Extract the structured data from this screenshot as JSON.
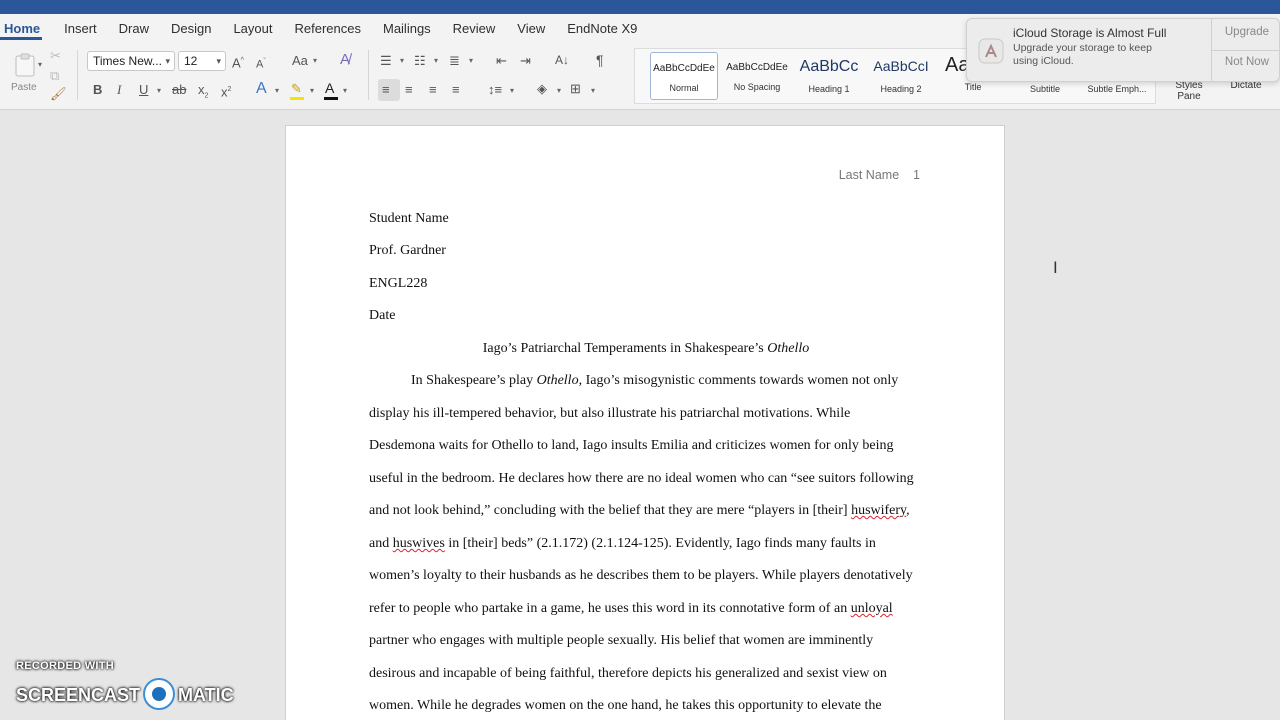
{
  "tabs": [
    {
      "label": "Home"
    },
    {
      "label": "Insert"
    },
    {
      "label": "Draw"
    },
    {
      "label": "Design"
    },
    {
      "label": "Layout"
    },
    {
      "label": "References"
    },
    {
      "label": "Mailings"
    },
    {
      "label": "Review"
    },
    {
      "label": "View"
    },
    {
      "label": "EndNote X9"
    }
  ],
  "clipboard": {
    "paste_label": "Paste"
  },
  "font": {
    "family": "Times New...",
    "size": "12"
  },
  "styles": [
    {
      "sample": "AaBbCcDdEe",
      "name": "Normal"
    },
    {
      "sample": "AaBbCcDdEe",
      "name": "No Spacing"
    },
    {
      "sample": "AaBbCc",
      "name": "Heading 1"
    },
    {
      "sample": "AaBbCcI",
      "name": "Heading 2"
    },
    {
      "sample": "Aa",
      "name": "Title"
    },
    {
      "sample": "",
      "name": "Subtitle"
    },
    {
      "sample": "",
      "name": "Subtle Emph..."
    }
  ],
  "right_ribbon": {
    "styles_pane_1": "Styles",
    "styles_pane_2": "Pane",
    "dictate": "Dictate"
  },
  "notification": {
    "title": "iCloud Storage is Almost Full",
    "body": "Upgrade your storage to keep using iCloud.",
    "upgrade": "Upgrade",
    "not_now": "Not Now"
  },
  "document": {
    "header": "Last Name    1",
    "student": "Student Name",
    "prof": "Prof. Gardner",
    "course": "ENGL228",
    "date": "Date",
    "title_pre": "Iago’s Patriarchal Temperaments in Shakespeare’s ",
    "title_italic": "Othello",
    "lines": [
      {
        "a": "In Shakespeare’s play ",
        "i": "Othello",
        "b": ", Iago’s misogynistic comments towards women not only"
      },
      {
        "a": "display his ill-tempered behavior, but also illustrate his patriarchal motivations. While"
      },
      {
        "a": "Desdemona waits for Othello to land, Iago insults Emilia and criticizes women for only being"
      },
      {
        "a": "useful in the bedroom. He declares how there are no ideal women who can “see suitors following"
      },
      {
        "a": "and not look behind,” concluding with the belief that they are mere “players in [their] ",
        "s": "huswifery",
        "b": ","
      },
      {
        "a": "and ",
        "s": "huswives",
        "b": " in [their] beds” (2.1.172) (2.1.124-125). Evidently, Iago finds many faults in"
      },
      {
        "a": "women’s loyalty to their husbands as he describes them to be players. While players denotatively"
      },
      {
        "a": "refer to people who partake in a game, he uses this word in its connotative form of an ",
        "s": "unloyal"
      },
      {
        "a": "partner who engages with multiple people sexually. His belief that women are imminently"
      },
      {
        "a": "desirous and incapable of being faithful, therefore depicts his generalized and sexist view on"
      },
      {
        "a": "women. While he degrades women on the one hand, he takes this opportunity to elevate the"
      }
    ]
  },
  "watermark": {
    "top": "RECORDED WITH",
    "left": "SCREENCAST",
    "right": "MATIC"
  },
  "colors": {
    "accent": "#2b579a",
    "squiggle": "#d23"
  }
}
